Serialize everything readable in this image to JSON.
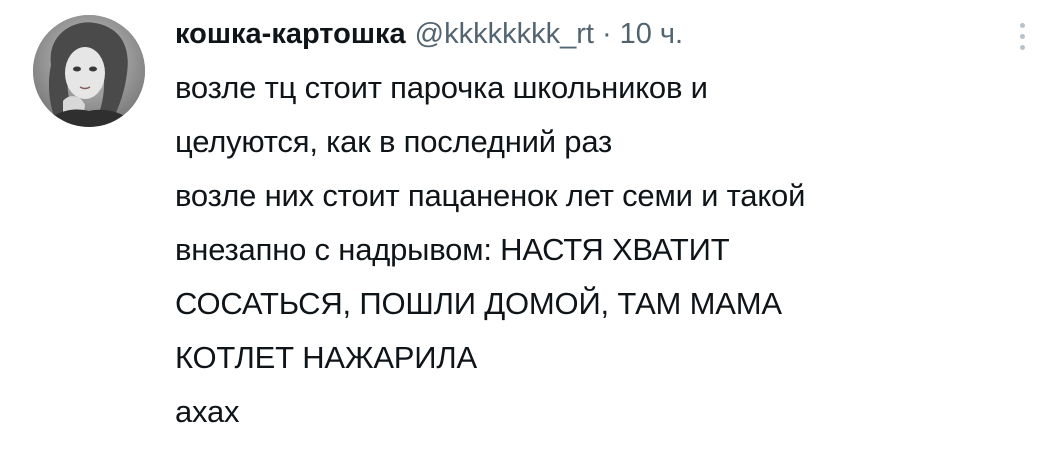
{
  "tweet": {
    "display_name": "кошка-картошка",
    "handle": "@kkkkkkkk_rt",
    "separator": "·",
    "timestamp": "10 ч.",
    "more_icon": "more-vertical-icon",
    "avatar_icon": "avatar-image",
    "text_lines": [
      "возле тц стоит парочка школьников и",
      "целуются, как в последний раз",
      "возле них стоит пацаненок лет семи и такой",
      "внезапно с надрывом: НАСТЯ ХВАТИТ",
      "СОСАТЬСЯ, ПОШЛИ ДОМОЙ, ТАМ МАМА",
      "КОТЛЕТ НАЖАРИЛА",
      "ахах"
    ]
  },
  "colors": {
    "text_primary": "#0f1419",
    "text_secondary": "#536471",
    "more_dots": "#b9c2c9",
    "background": "#ffffff"
  }
}
